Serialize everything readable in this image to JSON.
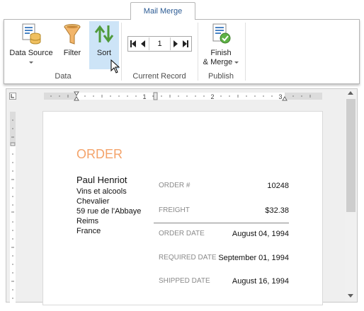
{
  "ribbon": {
    "active_tab": "Mail Merge",
    "groups": {
      "data": {
        "label": "Data",
        "data_source": "Data Source",
        "filter": "Filter",
        "sort": "Sort"
      },
      "current_record": {
        "label": "Current Record",
        "record_value": "1"
      },
      "publish": {
        "label": "Publish",
        "finish_merge_line1": "Finish",
        "finish_merge_line2": "& Merge"
      }
    }
  },
  "ruler": {
    "marks": [
      "1",
      "2",
      "3"
    ]
  },
  "document": {
    "title": "ORDER",
    "customer": {
      "name": "Paul Henriot",
      "lines": [
        "Vins et alcools",
        "Chevalier",
        "59 rue de l'Abbaye",
        "Reims",
        "France"
      ]
    },
    "fields": [
      {
        "label": "ORDER #",
        "value": "10248"
      },
      {
        "label": "FREIGHT",
        "value": "$32.38"
      },
      {
        "label": "ORDER DATE",
        "value": "August 04, 1994"
      },
      {
        "label": "REQUIRED DATE",
        "value": "September 01, 1994"
      },
      {
        "label": "SHIPPED DATE",
        "value": "August 16, 1994"
      }
    ]
  },
  "colors": {
    "accent": "#2b5a93",
    "title_orange": "#f4a36a",
    "selected_button": "#cde4f7"
  }
}
